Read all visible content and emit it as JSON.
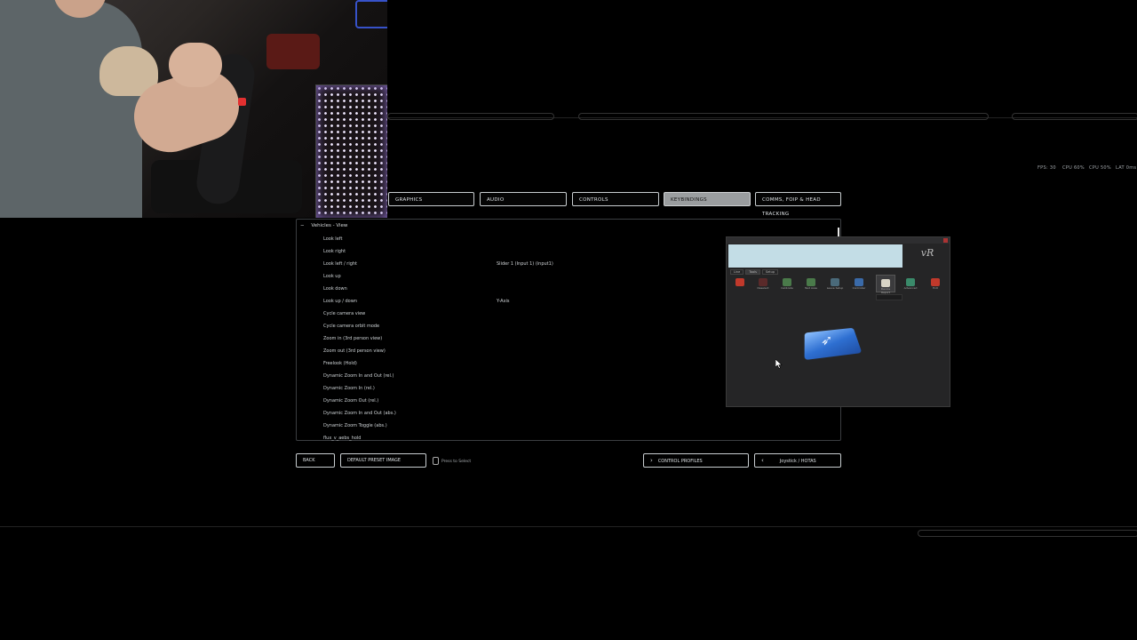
{
  "hud": {
    "fps": "FPS: 30",
    "cpu1": "CPU 60%",
    "cpu2": "CPU 50%",
    "lat": "LAT 0ms"
  },
  "tabs": [
    {
      "label": "GRAPHICS",
      "active": false
    },
    {
      "label": "AUDIO",
      "active": false
    },
    {
      "label": "CONTROLS",
      "active": false
    },
    {
      "label": "KEYBINDINGS",
      "active": true
    },
    {
      "label": "COMMS, FOIP & HEAD TRACKING",
      "active": false
    }
  ],
  "category": {
    "caret": "−",
    "label": "Vehicles - View"
  },
  "bindings": [
    {
      "label": "Look left",
      "value": ""
    },
    {
      "label": "Look right",
      "value": ""
    },
    {
      "label": "Look left / right",
      "value": "Slider 1 (Input 1) (input1)"
    },
    {
      "label": "Look up",
      "value": ""
    },
    {
      "label": "Look down",
      "value": ""
    },
    {
      "label": "Look up / down",
      "value": "Y-Axis"
    },
    {
      "label": "Cycle camera view",
      "value": ""
    },
    {
      "label": "Cycle camera orbit mode",
      "value": ""
    },
    {
      "label": "Zoom in (3rd person view)",
      "value": ""
    },
    {
      "label": "Zoom out (3rd person view)",
      "value": ""
    },
    {
      "label": "Freelook (Hold)",
      "value": ""
    },
    {
      "label": "Dynamic Zoom In and Out (rel.)",
      "value": ""
    },
    {
      "label": "Dynamic Zoom In (rel.)",
      "value": ""
    },
    {
      "label": "Dynamic Zoom Out (rel.)",
      "value": ""
    },
    {
      "label": "Dynamic Zoom In and Out (abs.)",
      "value": ""
    },
    {
      "label": "Dynamic Zoom Toggle (abs.)",
      "value": ""
    },
    {
      "label": "flux_v_aebs_hold",
      "value": ""
    }
  ],
  "buttons": {
    "back": "BACK",
    "default_preset": "DEFAULT PRESET IMAGE",
    "hint": "Press to Select",
    "control_profiles": "CONTROL PROFILES",
    "joystick": "Joystick / HOTAS"
  },
  "app_window": {
    "logo_text": "vR",
    "tabs": [
      "Line",
      "Tools",
      "Setup"
    ],
    "tools": [
      {
        "label": "",
        "color": "#c0392b"
      },
      {
        "label": "Deselect",
        "color": "#5a2a2a"
      },
      {
        "label": "Calibrate",
        "color": "#4a7a4a"
      },
      {
        "label": "Test Axes",
        "color": "#4a7a4a"
      },
      {
        "label": "Leave Setup",
        "color": "#4a6a7a"
      },
      {
        "label": "Controller",
        "color": "#3a6aa8"
      },
      {
        "label": "Device Report",
        "color": "#d8d4c6"
      },
      {
        "label": "Advanced",
        "color": "#3a8a6a"
      },
      {
        "label": "Exit",
        "color": "#c0392b"
      }
    ]
  }
}
